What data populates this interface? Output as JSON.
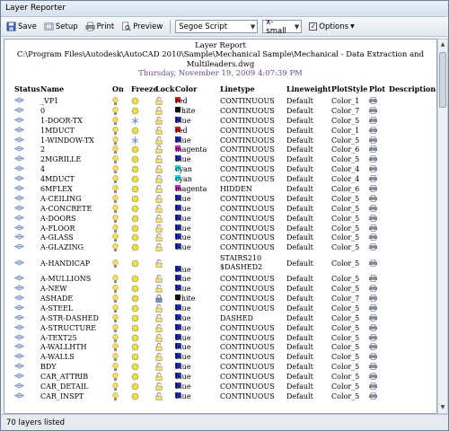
{
  "window": {
    "title": "Layer Reporter"
  },
  "toolbar": {
    "save": "Save",
    "setup": "Setup",
    "print": "Print",
    "preview": "Preview",
    "font": "Segoe Script",
    "size": "x-small",
    "options": "Options",
    "options_checked": "✓"
  },
  "report": {
    "title": "Layer Report",
    "path": "C:\\Program Files\\Autodesk\\AutoCAD 2010\\Sample\\Mechanical Sample\\Mechanical - Data Extraction and Multileaders.dwg",
    "date": "Thursday, November 19, 2009 4:07:39 PM"
  },
  "columns": [
    "Status",
    "Name",
    "On",
    "Freeze",
    "Lock",
    "Color",
    "Linetype",
    "Lineweight",
    "PlotStyle",
    "Plot",
    "Description"
  ],
  "colors": {
    "red": "#e02020",
    "white": "#111111",
    "blue": "#1f2fd0",
    "magenta": "#e020d0",
    "cyan": "#20d8e8",
    "bulb": "#f2dc6a",
    "freeze_sun": "#e8e050",
    "freeze_snow": "#6a86c8",
    "lock": "#7a8ec0",
    "accent": "#0e58b8"
  },
  "rows": [
    {
      "name": "_VP1",
      "color": "red",
      "lt": "CONTINUOUS",
      "lw": "Default",
      "ps": "Color_1",
      "freeze": "sun",
      "lock": "open"
    },
    {
      "name": "0",
      "color": "white",
      "lt": "CONTINUOUS",
      "lw": "Default",
      "ps": "Color_7",
      "freeze": "sun",
      "lock": "open"
    },
    {
      "name": "1-DOOR-TX",
      "color": "blue",
      "lt": "CONTINUOUS",
      "lw": "Default",
      "ps": "Color_5",
      "freeze": "snow",
      "lock": "open"
    },
    {
      "name": "1MDUCT",
      "color": "red",
      "lt": "CONTINUOUS",
      "lw": "Default",
      "ps": "Color_1",
      "freeze": "sun",
      "lock": "open"
    },
    {
      "name": "1-WINDOW-TX",
      "color": "blue",
      "lt": "CONTINUOUS",
      "lw": "Default",
      "ps": "Color_5",
      "freeze": "snow",
      "lock": "open"
    },
    {
      "name": "2",
      "color": "magenta",
      "lt": "CONTINUOUS",
      "lw": "Default",
      "ps": "Color_6",
      "freeze": "sun",
      "lock": "open"
    },
    {
      "name": "2MGRILLE",
      "color": "blue",
      "lt": "CONTINUOUS",
      "lw": "Default",
      "ps": "Color_5",
      "freeze": "sun",
      "lock": "open"
    },
    {
      "name": "4",
      "color": "cyan",
      "lt": "CONTINUOUS",
      "lw": "Default",
      "ps": "Color_4",
      "freeze": "sun",
      "lock": "open"
    },
    {
      "name": "4MDUCT",
      "color": "cyan",
      "lt": "CONTINUOUS",
      "lw": "Default",
      "ps": "Color_4",
      "freeze": "sun",
      "lock": "open"
    },
    {
      "name": "6MFLEX",
      "color": "magenta",
      "lt": "HIDDEN",
      "lw": "Default",
      "ps": "Color_6",
      "freeze": "sun",
      "lock": "open"
    },
    {
      "name": "A-CEILING",
      "color": "blue",
      "lt": "CONTINUOUS",
      "lw": "Default",
      "ps": "Color_5",
      "freeze": "sun",
      "lock": "open"
    },
    {
      "name": "A-CONCRETE",
      "color": "blue",
      "lt": "CONTINUOUS",
      "lw": "Default",
      "ps": "Color_5",
      "freeze": "sun",
      "lock": "open"
    },
    {
      "name": "A-DOORS",
      "color": "blue",
      "lt": "CONTINUOUS",
      "lw": "Default",
      "ps": "Color_5",
      "freeze": "sun",
      "lock": "open"
    },
    {
      "name": "A-FLOOR",
      "color": "blue",
      "lt": "CONTINUOUS",
      "lw": "Default",
      "ps": "Color_5",
      "freeze": "sun",
      "lock": "open"
    },
    {
      "name": "A-GLASS",
      "color": "blue",
      "lt": "CONTINUOUS",
      "lw": "Default",
      "ps": "Color_5",
      "freeze": "sun",
      "lock": "open"
    },
    {
      "name": "A-GLAZING",
      "color": "blue",
      "lt": "CONTINUOUS",
      "lw": "Default",
      "ps": "Color_5",
      "freeze": "sun",
      "lock": "open"
    },
    {
      "name": "A-HANDICAP",
      "color": "blue",
      "lt": "STAIRS210\n$DASHED2",
      "lw": "Default",
      "ps": "Color_5",
      "freeze": "sun",
      "lock": "open",
      "tall": true
    },
    {
      "name": "A-MULLIONS",
      "color": "blue",
      "lt": "CONTINUOUS",
      "lw": "Default",
      "ps": "Color_5",
      "freeze": "sun",
      "lock": "open"
    },
    {
      "name": "A-NEW",
      "color": "blue",
      "lt": "CONTINUOUS",
      "lw": "Default",
      "ps": "Color_5",
      "freeze": "sun",
      "lock": "open"
    },
    {
      "name": "ASHADE",
      "color": "white",
      "lt": "CONTINUOUS",
      "lw": "Default",
      "ps": "Color_7",
      "freeze": "sun",
      "lock": "locked"
    },
    {
      "name": "A-STEEL",
      "color": "blue",
      "lt": "CONTINUOUS",
      "lw": "Default",
      "ps": "Color_5",
      "freeze": "sun",
      "lock": "open"
    },
    {
      "name": "A-STR-DASHED",
      "color": "blue",
      "lt": "DASHED",
      "lw": "Default",
      "ps": "Color_5",
      "freeze": "sun",
      "lock": "open"
    },
    {
      "name": "A-STRUCTURE",
      "color": "blue",
      "lt": "CONTINUOUS",
      "lw": "Default",
      "ps": "Color_5",
      "freeze": "sun",
      "lock": "open"
    },
    {
      "name": "A-TEXT25",
      "color": "blue",
      "lt": "CONTINUOUS",
      "lw": "Default",
      "ps": "Color_5",
      "freeze": "sun",
      "lock": "open"
    },
    {
      "name": "A-WALLHTH",
      "color": "blue",
      "lt": "CONTINUOUS",
      "lw": "Default",
      "ps": "Color_5",
      "freeze": "sun",
      "lock": "open"
    },
    {
      "name": "A-WALLS",
      "color": "blue",
      "lt": "CONTINUOUS",
      "lw": "Default",
      "ps": "Color_5",
      "freeze": "sun",
      "lock": "open"
    },
    {
      "name": "BDY",
      "color": "blue",
      "lt": "CONTINUOUS",
      "lw": "Default",
      "ps": "Color_5",
      "freeze": "sun",
      "lock": "open"
    },
    {
      "name": "CAR_ATTRIB",
      "color": "blue",
      "lt": "CONTINUOUS",
      "lw": "Default",
      "ps": "Color_5",
      "freeze": "sun",
      "lock": "open"
    },
    {
      "name": "CAR_DETAIL",
      "color": "blue",
      "lt": "CONTINUOUS",
      "lw": "Default",
      "ps": "Color_5",
      "freeze": "sun",
      "lock": "open"
    },
    {
      "name": "CAR_INSPT",
      "color": "blue",
      "lt": "CONTINUOUS",
      "lw": "Default",
      "ps": "Color_5",
      "freeze": "sun",
      "lock": "open"
    }
  ],
  "status": {
    "text": "70 layers listed"
  }
}
